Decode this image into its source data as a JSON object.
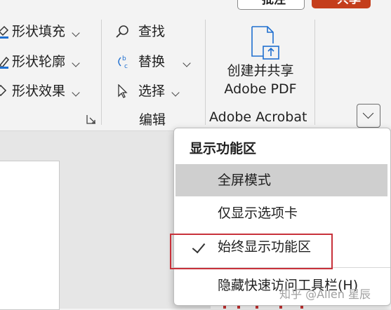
{
  "top_buttons": {
    "comment_label": "批注",
    "share_label": "共享"
  },
  "drawing_group": {
    "items": [
      {
        "label": "形状填充"
      },
      {
        "label": "形状轮廓"
      },
      {
        "label": "形状效果"
      }
    ]
  },
  "editing_group": {
    "items": [
      {
        "label": "查找"
      },
      {
        "label": "替换"
      },
      {
        "label": "选择"
      }
    ],
    "group_label": "编辑"
  },
  "acrobat_group": {
    "button_line1": "创建并共享",
    "button_line2": "Adobe PDF",
    "group_label": "Adobe Acrobat"
  },
  "ribbon_display_menu": {
    "header": "显示功能区",
    "items": [
      {
        "label": "全屏模式",
        "hovered": true,
        "checked": false
      },
      {
        "label": "仅显示选项卡",
        "hovered": false,
        "checked": false
      },
      {
        "label": "始终显示功能区",
        "hovered": false,
        "checked": true
      },
      {
        "label": "隐藏快速访问工具栏(H)",
        "hovered": false,
        "checked": false
      }
    ]
  },
  "watermark": "知乎 @Allen 星辰",
  "colors": {
    "share_button": "#c43e1c",
    "highlight_box": "#c8313a",
    "hover_row": "#cfcfcf"
  }
}
